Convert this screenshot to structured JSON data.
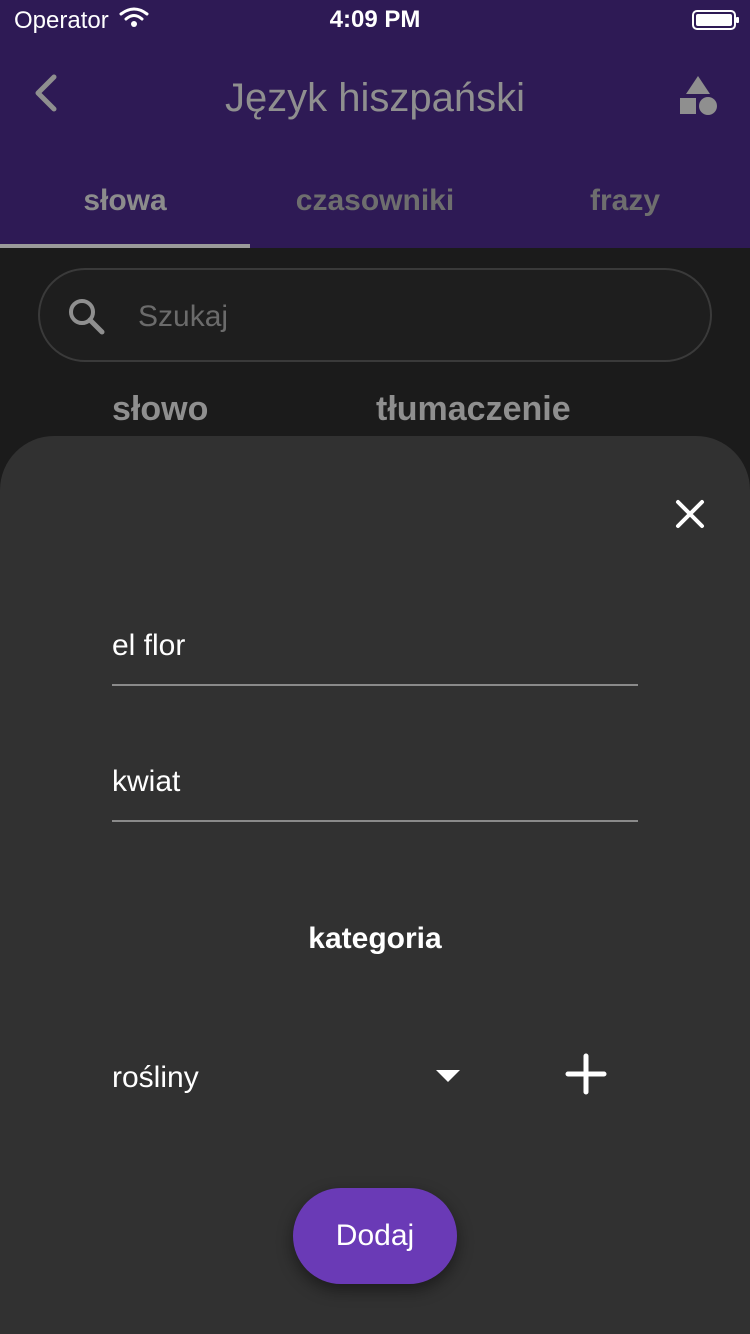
{
  "status_bar": {
    "carrier": "Operator",
    "time": "4:09 PM",
    "battery_icon": "battery-icon",
    "wifi_icon": "wifi-icon"
  },
  "appbar": {
    "title": "Język hiszpański",
    "back_icon": "chevron-left-icon",
    "shapes_icon": "shapes-icon"
  },
  "tabs": [
    {
      "label": "słowa"
    },
    {
      "label": "czasowniki"
    },
    {
      "label": "frazy"
    }
  ],
  "search": {
    "placeholder": "Szukaj",
    "icon": "search-icon"
  },
  "list_headers": {
    "word": "słowo",
    "translation": "tłumaczenie"
  },
  "sheet": {
    "close_icon": "close-icon",
    "word_value": "el flor",
    "translation_value": "kwiat",
    "category_label": "kategoria",
    "category_selected": "rośliny",
    "dropdown_icon": "caret-down-icon",
    "add_icon": "plus-icon",
    "submit_label": "Dodaj"
  },
  "colors": {
    "header_bg": "#2e1a55",
    "sheet_bg": "#313131",
    "accent": "#6a3ab6"
  }
}
